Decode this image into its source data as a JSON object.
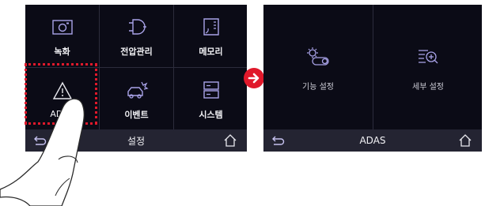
{
  "left_screen": {
    "menu": [
      {
        "label": "녹화",
        "icon": "camera-icon"
      },
      {
        "label": "전압관리",
        "icon": "plug-icon"
      },
      {
        "label": "메모리",
        "icon": "sd-card-icon"
      },
      {
        "label": "ADAS",
        "icon": "warning-triangle-icon"
      },
      {
        "label": "이벤트",
        "icon": "car-collision-icon"
      },
      {
        "label": "시스템",
        "icon": "server-icon"
      }
    ],
    "title": "설정"
  },
  "right_screen": {
    "items": [
      {
        "label": "기능 설정",
        "icon": "feature-settings-icon"
      },
      {
        "label": "세부 설정",
        "icon": "detail-settings-icon"
      }
    ],
    "title": "ADAS"
  },
  "colors": {
    "screen_bg": "#0b0b16",
    "bar_bg": "#242432",
    "highlight": "#e0192b",
    "icon_purple": "#a9a3e8"
  }
}
